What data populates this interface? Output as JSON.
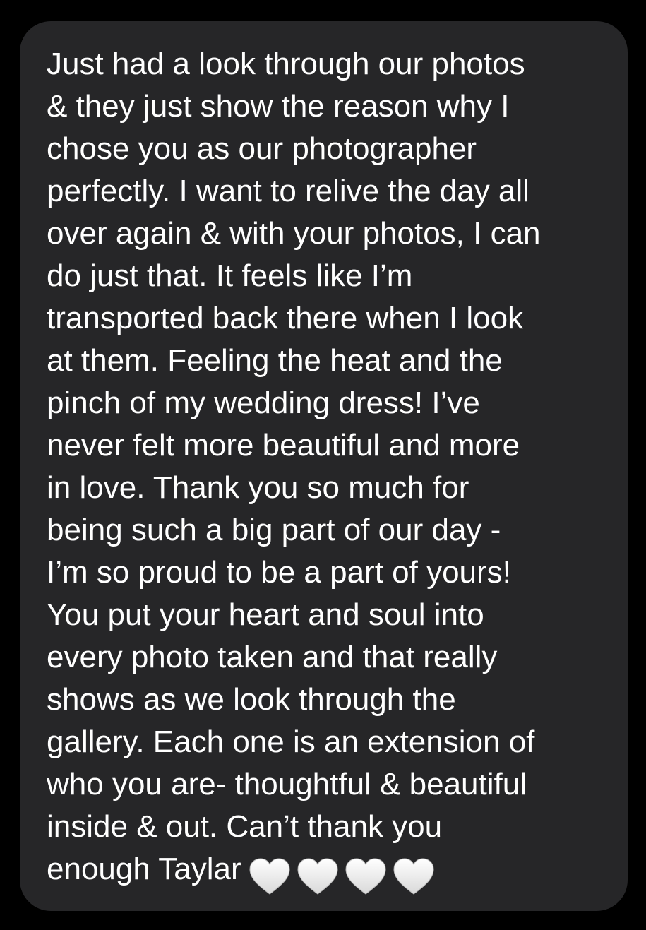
{
  "message": {
    "lines": [
      "Just had a look through our photos",
      "& they just show the reason why I",
      "chose you as our photographer",
      "perfectly. I want to relive the day all",
      "over again & with your photos, I can",
      "do just that. It feels like I’m",
      "transported back there when I look",
      "at them. Feeling the heat and the",
      "pinch of my wedding dress! I’ve",
      "never felt more beautiful and more",
      "in love. Thank you so much for",
      "being such a big part of our day -",
      "I’m so proud to be a part of yours!",
      "You put your heart and soul into",
      "every photo taken and that really",
      "shows as we look through the",
      "gallery. Each one is an extension of",
      "who you are- thoughtful & beautiful",
      "inside & out. Can’t thank you",
      "enough Taylar"
    ],
    "emoji": [
      "white-heart-icon",
      "white-heart-icon",
      "white-heart-icon",
      "white-heart-icon"
    ],
    "bubble_color": "#262628",
    "text_color": "#ffffff",
    "background_color": "#000000"
  }
}
